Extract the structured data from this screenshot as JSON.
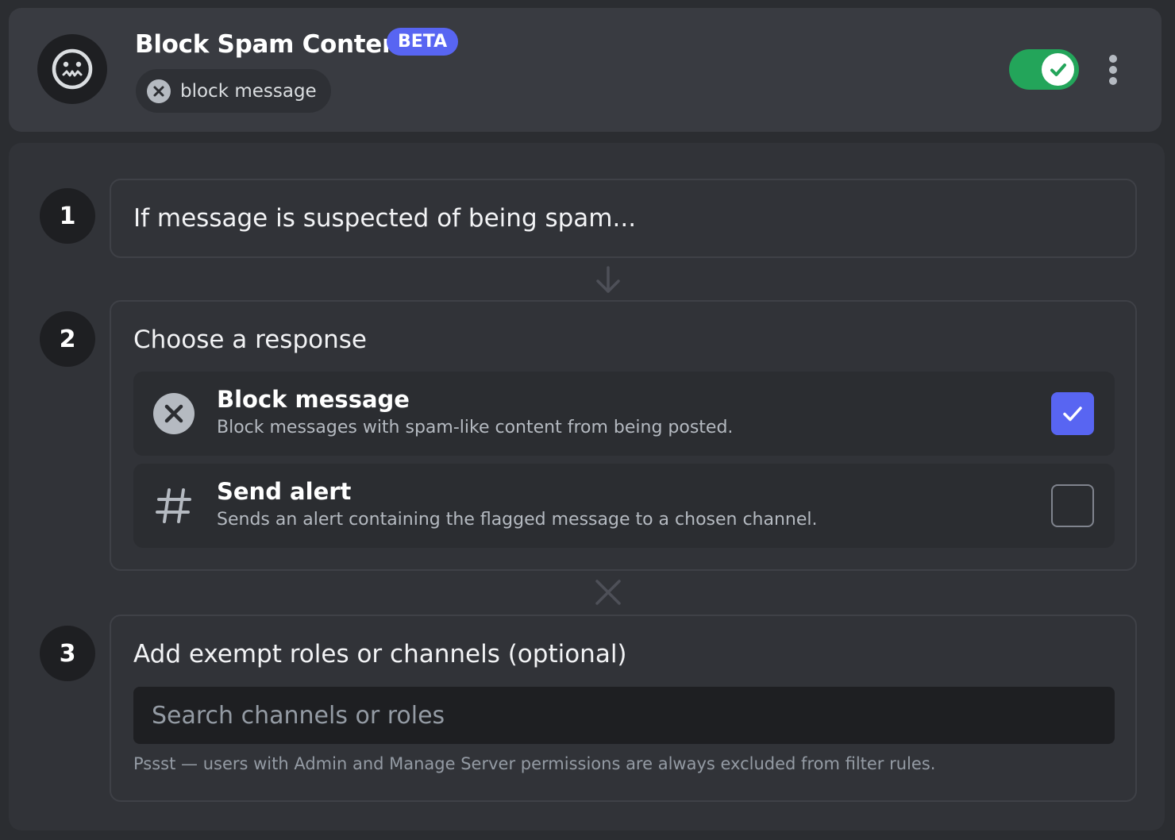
{
  "rule": {
    "title": "Block Spam Content",
    "badge": "BETA",
    "action_chip": "block message",
    "enabled": true
  },
  "steps": [
    {
      "number": "1",
      "text": "If message is suspected of being spam..."
    },
    {
      "number": "2",
      "text": "Choose a response"
    },
    {
      "number": "3",
      "text": "Add exempt roles or channels (optional)"
    }
  ],
  "responses": [
    {
      "title": "Block message",
      "description": "Block messages with spam-like content from being posted.",
      "icon": "x-circle-icon",
      "checked": true
    },
    {
      "title": "Send alert",
      "description": "Sends an alert containing the flagged message to a chosen channel.",
      "icon": "hashtag-icon",
      "checked": false
    }
  ],
  "exempt": {
    "placeholder": "Search channels or roles",
    "hint": "Pssst — users with Admin and Manage Server permissions are always excluded from filter rules."
  },
  "colors": {
    "accent": "#5865f2",
    "toggle_on": "#23a55a"
  }
}
